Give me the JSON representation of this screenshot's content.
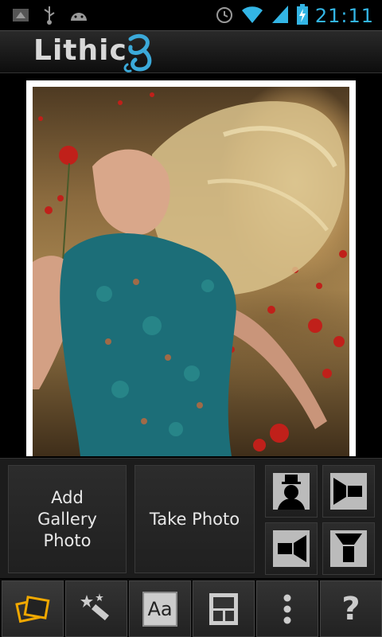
{
  "status_bar": {
    "time": "21:11",
    "icons": [
      "notification-icon",
      "usb-icon",
      "android-icon",
      "alarm-icon",
      "wifi-icon",
      "signal-icon",
      "battery-charging-icon"
    ],
    "accent_color": "#33b5e5"
  },
  "app": {
    "title": "Lithic",
    "logo_icon": "swirl-logo-icon"
  },
  "controls": {
    "add_gallery_photo_label": "Add Gallery Photo",
    "take_photo_label": "Take Photo",
    "lighting_buttons": [
      "light-top-icon",
      "light-right-icon",
      "light-left-icon",
      "light-bottom-icon"
    ]
  },
  "toolbar": {
    "items": [
      {
        "name": "photos-tool",
        "icon": "photos-icon",
        "active": true
      },
      {
        "name": "effects-tool",
        "icon": "magic-wand-icon",
        "active": false
      },
      {
        "name": "text-tool",
        "icon": "text-aa-icon",
        "label": "Aa",
        "active": false
      },
      {
        "name": "layout-tool",
        "icon": "layout-icon",
        "active": false
      },
      {
        "name": "more-tool",
        "icon": "overflow-menu-icon",
        "active": false
      },
      {
        "name": "help-tool",
        "icon": "help-icon",
        "label": "?",
        "active": false
      }
    ]
  }
}
